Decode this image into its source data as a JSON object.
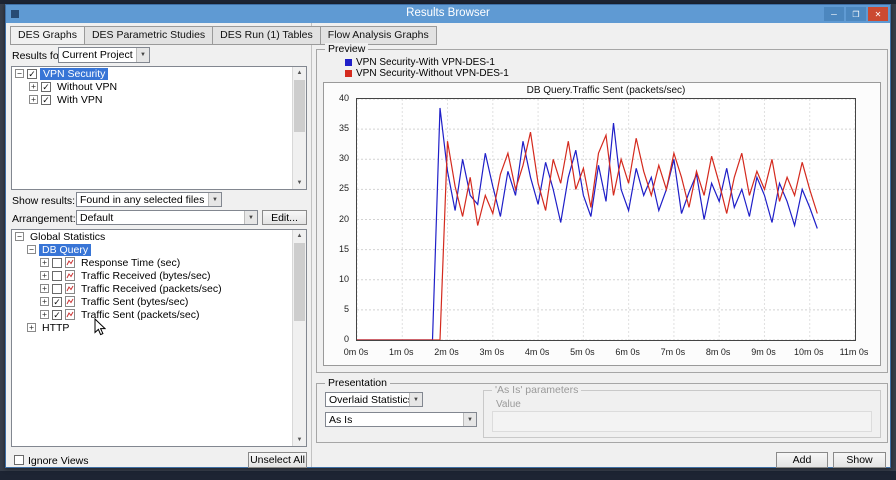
{
  "window": {
    "title": "Results Browser"
  },
  "icons": {
    "minimize": "─",
    "maximize": "❐",
    "close": "✕",
    "dropdown": "▼",
    "scroll_up": "▲",
    "scroll_down": "▼",
    "check": "✓",
    "expand": "+",
    "collapse": "−"
  },
  "tabs": [
    "DES Graphs",
    "DES Parametric Studies",
    "DES Run (1) Tables",
    "Flow Analysis Graphs"
  ],
  "left": {
    "results_for_label": "Results for:",
    "results_for_value": "Current Project",
    "project_tree": [
      {
        "label": "VPN Security",
        "expanded": true,
        "checked": true,
        "selected": true,
        "level": 0
      },
      {
        "label": "Without VPN",
        "expanded": false,
        "checked": true,
        "selected": false,
        "level": 1
      },
      {
        "label": "With VPN",
        "expanded": false,
        "checked": true,
        "selected": false,
        "level": 1
      }
    ],
    "show_results_label": "Show results:",
    "show_results_value": "Found in any selected files",
    "arrangement_label": "Arrangement:",
    "arrangement_value": "Default",
    "edit_button": "Edit...",
    "stats_tree": [
      {
        "label": "Global Statistics",
        "level": 0,
        "expanded": true,
        "selected": false
      },
      {
        "label": "DB Query",
        "level": 1,
        "expanded": true,
        "selected": true
      },
      {
        "label": "Response Time (sec)",
        "level": 2,
        "expanded": false,
        "checked": false,
        "selected": false
      },
      {
        "label": "Traffic Received (bytes/sec)",
        "level": 2,
        "expanded": false,
        "checked": false,
        "selected": false
      },
      {
        "label": "Traffic Received (packets/sec)",
        "level": 2,
        "expanded": false,
        "checked": false,
        "selected": false
      },
      {
        "label": "Traffic Sent (bytes/sec)",
        "level": 2,
        "expanded": false,
        "checked": true,
        "selected": false
      },
      {
        "label": "Traffic Sent (packets/sec)",
        "level": 2,
        "expanded": false,
        "checked": true,
        "selected": false
      },
      {
        "label": "HTTP",
        "level": 1,
        "expanded": false,
        "selected": false
      }
    ],
    "ignore_views_label": "Ignore Views",
    "unselect_all_button": "Unselect All"
  },
  "preview": {
    "group_label": "Preview"
  },
  "presentation": {
    "group_label": "Presentation",
    "style_value": "Overlaid Statistics",
    "mode_value": "As Is",
    "params_group_label": "'As Is' parameters",
    "params_value_label": "Value"
  },
  "buttons": {
    "add": "Add",
    "show": "Show"
  },
  "chart_data": {
    "type": "line",
    "title": "DB Query.Traffic Sent (packets/sec)",
    "xlabel": "",
    "ylabel": "",
    "ylim": [
      0,
      40
    ],
    "y_ticks": [
      0,
      5,
      10,
      15,
      20,
      25,
      30,
      35,
      40
    ],
    "xlim_seconds": [
      0,
      660
    ],
    "x_tick_seconds": [
      0,
      60,
      120,
      180,
      240,
      300,
      360,
      420,
      480,
      540,
      600,
      660
    ],
    "x_tick_labels": [
      "0m 0s",
      "1m 0s",
      "2m 0s",
      "3m 0s",
      "4m 0s",
      "5m 0s",
      "6m 0s",
      "7m 0s",
      "8m 0s",
      "9m 0s",
      "10m 0s",
      "11m 0s"
    ],
    "grid": true,
    "legend_position": "top-left",
    "x_seconds": [
      0,
      10,
      20,
      30,
      40,
      50,
      60,
      70,
      80,
      90,
      100,
      110,
      120,
      130,
      140,
      150,
      160,
      170,
      180,
      190,
      200,
      210,
      220,
      230,
      240,
      250,
      260,
      270,
      280,
      290,
      300,
      310,
      320,
      330,
      340,
      350,
      360,
      370,
      380,
      390,
      400,
      410,
      420,
      430,
      440,
      450,
      460,
      470,
      480,
      490,
      500,
      510,
      520,
      530,
      540,
      550,
      560,
      570,
      580,
      590,
      600,
      610
    ],
    "series": [
      {
        "name": "VPN Security-With VPN-DES-1",
        "color": "#1f1fc8",
        "values": [
          0,
          0,
          0,
          0,
          0,
          0,
          0,
          0,
          0,
          0,
          0,
          38.5,
          28,
          21.5,
          30,
          24,
          22.5,
          31,
          25.5,
          20.5,
          28,
          24,
          33,
          27,
          22.5,
          29.5,
          25,
          19.5,
          27,
          31.5,
          24,
          20.5,
          29,
          23,
          36,
          25,
          21.5,
          28.5,
          24,
          27,
          21.5,
          25,
          30,
          21,
          24.5,
          27.5,
          20,
          26,
          23,
          28.5,
          22,
          25,
          20.5,
          27,
          24,
          19.5,
          26,
          23,
          19,
          25,
          22,
          18.5
        ]
      },
      {
        "name": "VPN Security-Without VPN-DES-1",
        "color": "#d42a1e",
        "values": [
          0,
          0,
          0,
          0,
          0,
          0,
          0,
          0,
          0,
          0,
          0,
          0,
          33,
          25.5,
          20.5,
          27,
          19,
          24,
          21,
          27.5,
          31,
          25,
          29,
          34.5,
          26,
          21.5,
          30,
          26,
          33,
          25,
          28.5,
          22,
          31,
          34,
          24,
          30,
          26,
          33.5,
          28,
          24,
          29,
          25,
          31,
          27,
          22,
          28,
          24,
          30.5,
          26,
          21,
          27,
          31,
          24,
          28,
          25,
          30,
          23,
          27,
          24,
          29.5,
          25,
          21
        ]
      }
    ]
  }
}
